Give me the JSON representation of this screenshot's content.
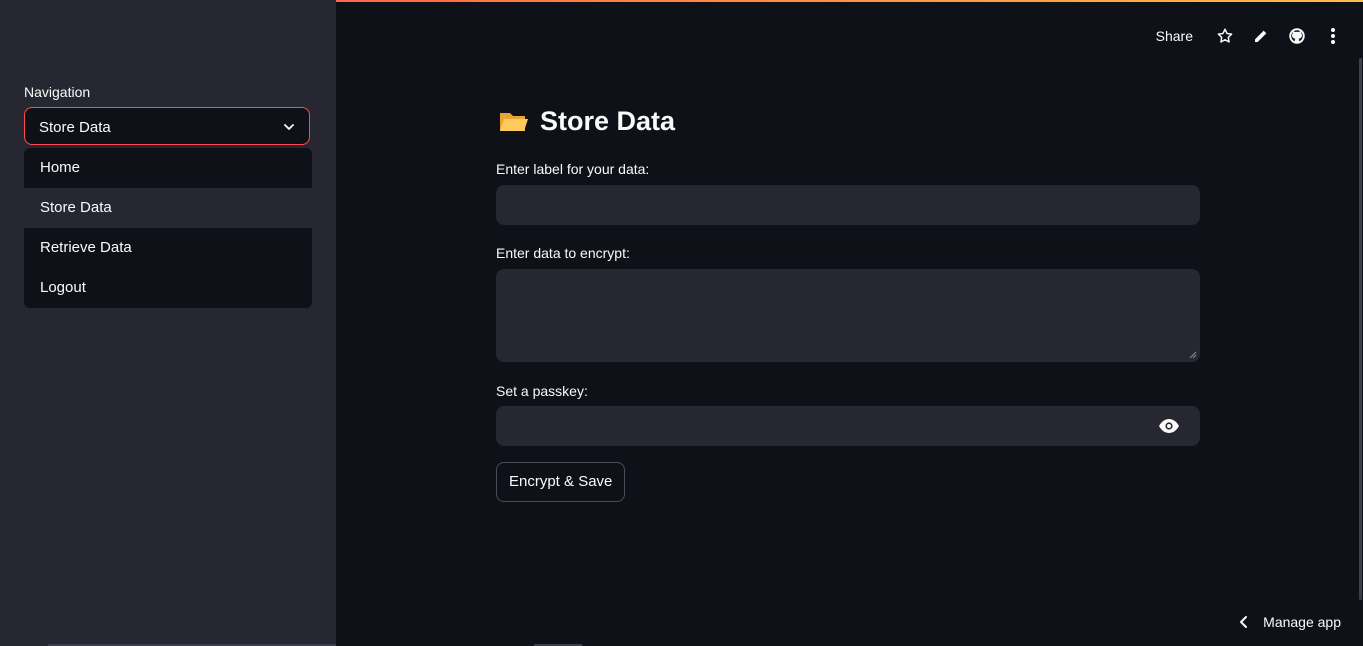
{
  "sidebar": {
    "nav_label": "Navigation",
    "selected": "Store Data",
    "options": [
      "Home",
      "Store Data",
      "Retrieve Data",
      "Logout"
    ],
    "active_index": 1
  },
  "toolbar": {
    "share_label": "Share",
    "icons": [
      "star-icon",
      "pencil-icon",
      "github-icon",
      "more-vertical-icon"
    ]
  },
  "main": {
    "title_emoji": "folder-icon",
    "title": "Store Data",
    "label_field": {
      "label": "Enter label for your data:",
      "value": ""
    },
    "data_field": {
      "label": "Enter data to encrypt:",
      "value": ""
    },
    "passkey_field": {
      "label": "Set a passkey:",
      "value": ""
    },
    "submit_label": "Encrypt & Save"
  },
  "footer": {
    "manage_label": "Manage app"
  },
  "colors": {
    "accent": "#ff4b4b",
    "background": "#0e1117",
    "sidebar": "#262730",
    "input": "#262730"
  }
}
